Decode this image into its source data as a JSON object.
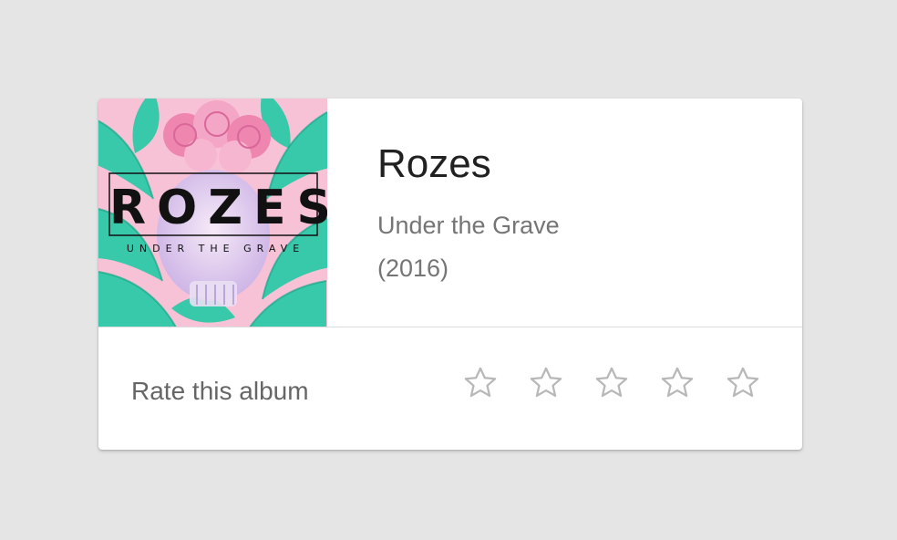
{
  "album": {
    "artist": "Rozes",
    "title": "Under the Grave",
    "year": "(2016)",
    "cover": {
      "logo_text": "ROZES",
      "subtitle_text": "UNDER THE GRAVE",
      "palette": {
        "leaf": "#2ec9a8",
        "leaf_dark": "#16a88a",
        "pink": "#f4a6c6",
        "rose": "#ee86b0",
        "skull": "#e9d8f1"
      }
    }
  },
  "rating": {
    "label": "Rate this album",
    "max_stars": 5,
    "current": 0,
    "star_icons": [
      "star-outline-icon",
      "star-outline-icon",
      "star-outline-icon",
      "star-outline-icon",
      "star-outline-icon"
    ]
  },
  "colors": {
    "background": "#e5e5e5",
    "card": "#ffffff",
    "star_outline": "#b8b8b8",
    "primary_text": "#212121",
    "secondary_text": "#757575"
  }
}
